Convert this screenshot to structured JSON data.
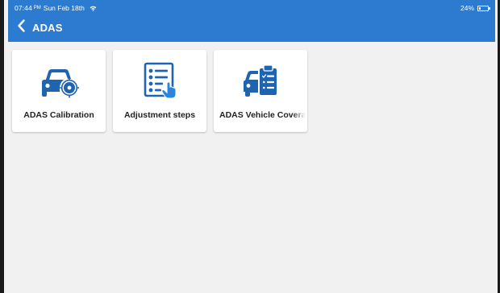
{
  "status_bar": {
    "time": "07:44",
    "ampm": "PM",
    "date": "Sun Feb 18th",
    "wifi_icon": "wifi-icon",
    "battery_percent": "24%",
    "battery_level": 0.24
  },
  "header": {
    "back_icon": "chevron-left-icon",
    "title": "ADAS",
    "color": "#2c7bd0"
  },
  "tiles": [
    {
      "label": "ADAS Calibration",
      "icon": "car-target-icon"
    },
    {
      "label": "Adjustment steps",
      "icon": "checklist-icon"
    },
    {
      "label": "ADAS Vehicle Coverage",
      "icon": "car-clipboard-icon"
    }
  ],
  "colors": {
    "accent": "#2c7bd0",
    "icon": "#1e64b0",
    "background": "#f1f1f1"
  }
}
